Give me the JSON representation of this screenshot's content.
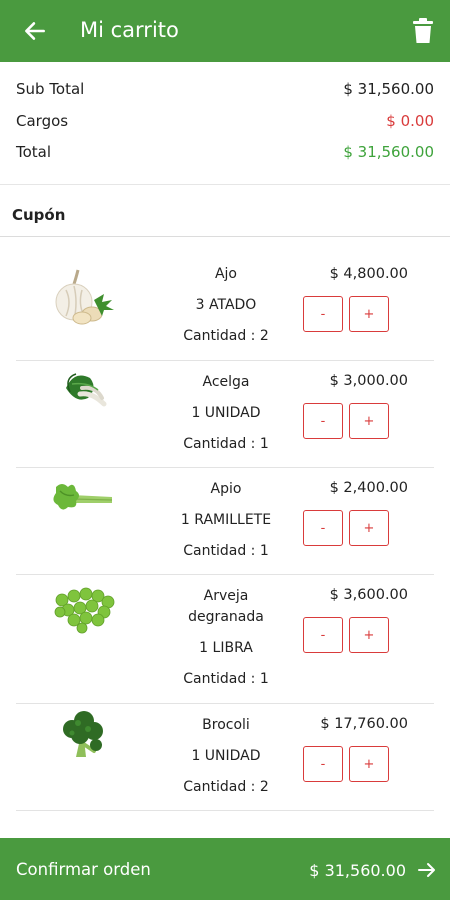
{
  "header": {
    "title": "Mi carrito",
    "back_icon": "arrow-left-icon",
    "trash_icon": "trash-icon"
  },
  "summary": {
    "subtotal_label": "Sub Total",
    "subtotal_value": "$ 31,560.00",
    "charges_label": "Cargos",
    "charges_value": "$ 0.00",
    "total_label": "Total",
    "total_value": "$ 31,560.00"
  },
  "coupon": {
    "label": "Cupón"
  },
  "items": [
    {
      "name": "Ajo",
      "unit": "3 ATADO",
      "qty": "Cantidad : 2",
      "price": "$ 4,800.00",
      "minus": "-",
      "plus": "+",
      "icon": "garlic-icon"
    },
    {
      "name": "Acelga",
      "unit": "1 UNIDAD",
      "qty": "Cantidad : 1",
      "price": "$ 3,000.00",
      "minus": "-",
      "plus": "+",
      "icon": "chard-icon"
    },
    {
      "name": "Apio",
      "unit": "1 RAMILLETE",
      "qty": "Cantidad : 1",
      "price": "$ 2,400.00",
      "minus": "-",
      "plus": "+",
      "icon": "celery-icon"
    },
    {
      "name": "Arveja degranada",
      "unit": "1 LIBRA",
      "qty": "Cantidad : 1",
      "price": "$ 3,600.00",
      "minus": "-",
      "plus": "+",
      "icon": "peas-icon"
    },
    {
      "name": "Brocoli",
      "unit": "1 UNIDAD",
      "qty": "Cantidad : 2",
      "price": "$ 17,760.00",
      "minus": "-",
      "plus": "+",
      "icon": "broccoli-icon"
    }
  ],
  "footer": {
    "confirm_label": "Confirmar orden",
    "total": "$ 31,560.00",
    "arrow_icon": "arrow-right-icon"
  },
  "colors": {
    "brand_green": "#4a9a3f",
    "accent_red": "#d93b3b",
    "total_green": "#3ea33b"
  }
}
